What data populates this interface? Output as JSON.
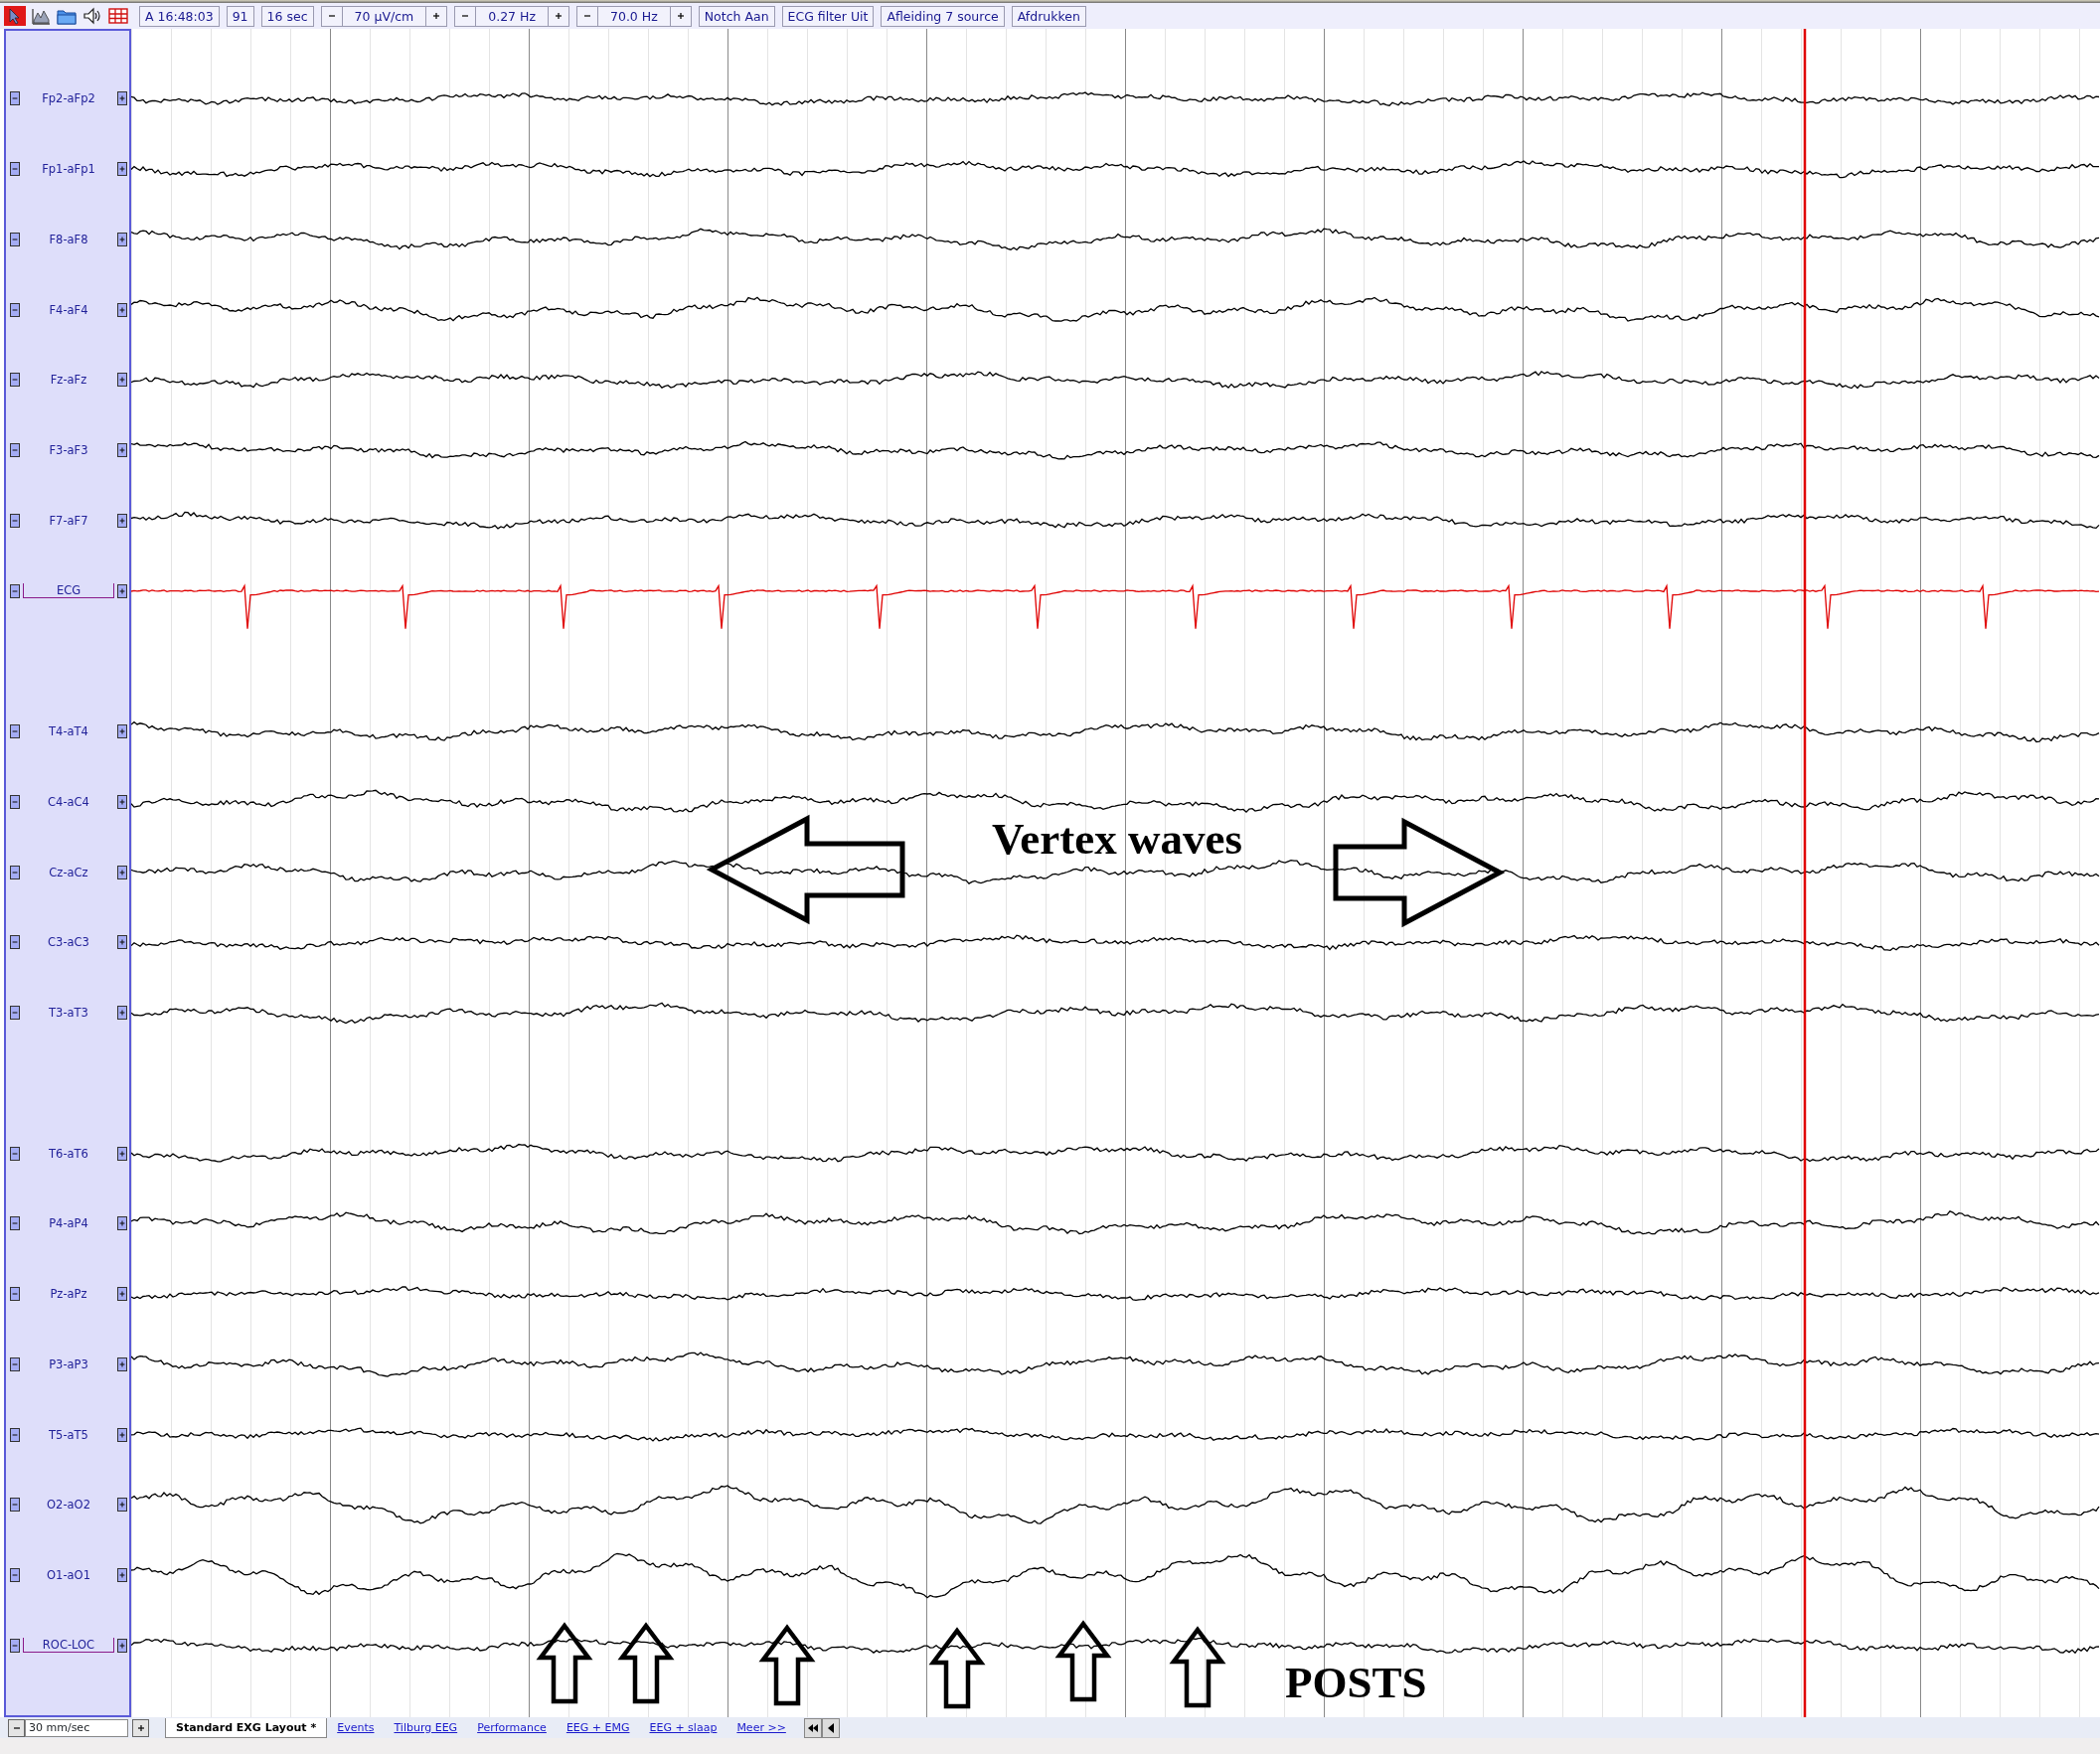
{
  "toolbar": {
    "time": "A 16:48:03",
    "page": "91",
    "duration": "16 sec",
    "spinners": [
      {
        "value": "70 µV/cm"
      },
      {
        "value": "0.27 Hz"
      },
      {
        "value": "70.0 Hz"
      }
    ],
    "buttons": [
      "Notch Aan",
      "ECG filter Uit",
      "Afleiding 7 source",
      "Afdrukken"
    ]
  },
  "channels": [
    {
      "kind": "eeg",
      "label": "Fp2-aFp2",
      "color": "#000000",
      "marked": false
    },
    {
      "kind": "eeg",
      "label": "Fp1-aFp1",
      "color": "#000000",
      "marked": false
    },
    {
      "kind": "eeg",
      "label": "F8-aF8",
      "color": "#000000",
      "marked": false
    },
    {
      "kind": "eeg",
      "label": "F4-aF4",
      "color": "#000000",
      "marked": false
    },
    {
      "kind": "eeg",
      "label": "Fz-aFz",
      "color": "#000000",
      "marked": false
    },
    {
      "kind": "eeg",
      "label": "F3-aF3",
      "color": "#000000",
      "marked": false
    },
    {
      "kind": "eeg",
      "label": "F7-aF7",
      "color": "#000000",
      "marked": false
    },
    {
      "kind": "ecg",
      "label": "ECG",
      "color": "#e00000",
      "marked": true
    },
    {
      "kind": "spacer"
    },
    {
      "kind": "eeg",
      "label": "T4-aT4",
      "color": "#000000",
      "marked": false
    },
    {
      "kind": "eeg",
      "label": "C4-aC4",
      "color": "#000000",
      "marked": false
    },
    {
      "kind": "eeg",
      "label": "Cz-aCz",
      "color": "#000000",
      "marked": false
    },
    {
      "kind": "eeg",
      "label": "C3-aC3",
      "color": "#000000",
      "marked": false
    },
    {
      "kind": "eeg",
      "label": "T3-aT3",
      "color": "#000000",
      "marked": false
    },
    {
      "kind": "spacer"
    },
    {
      "kind": "eeg",
      "label": "T6-aT6",
      "color": "#000000",
      "marked": false
    },
    {
      "kind": "eeg",
      "label": "P4-aP4",
      "color": "#000000",
      "marked": false
    },
    {
      "kind": "eeg",
      "label": "Pz-aPz",
      "color": "#000000",
      "marked": false
    },
    {
      "kind": "eeg",
      "label": "P3-aP3",
      "color": "#000000",
      "marked": false
    },
    {
      "kind": "eeg",
      "label": "T5-aT5",
      "color": "#000000",
      "marked": false
    },
    {
      "kind": "eeg",
      "label": "O2-aO2",
      "color": "#000000",
      "marked": false
    },
    {
      "kind": "eeg",
      "label": "O1-aO1",
      "color": "#000000",
      "marked": false
    },
    {
      "kind": "eeg",
      "label": "ROC-LOC",
      "color": "#000000",
      "marked": true
    }
  ],
  "annotations": {
    "vertex_label": "Vertex waves",
    "posts_label": "POSTS"
  },
  "bottom": {
    "speed": "30 mm/sec",
    "tabs": [
      {
        "label": "Standard EXG Layout *",
        "selected": true
      },
      {
        "label": "Events",
        "selected": false
      },
      {
        "label": "Tilburg EEG",
        "selected": false
      },
      {
        "label": "Performance",
        "selected": false
      },
      {
        "label": "EEG + EMG",
        "selected": false
      },
      {
        "label": "EEG + slaap",
        "selected": false
      },
      {
        "label": "Meer >>",
        "selected": false
      }
    ]
  }
}
